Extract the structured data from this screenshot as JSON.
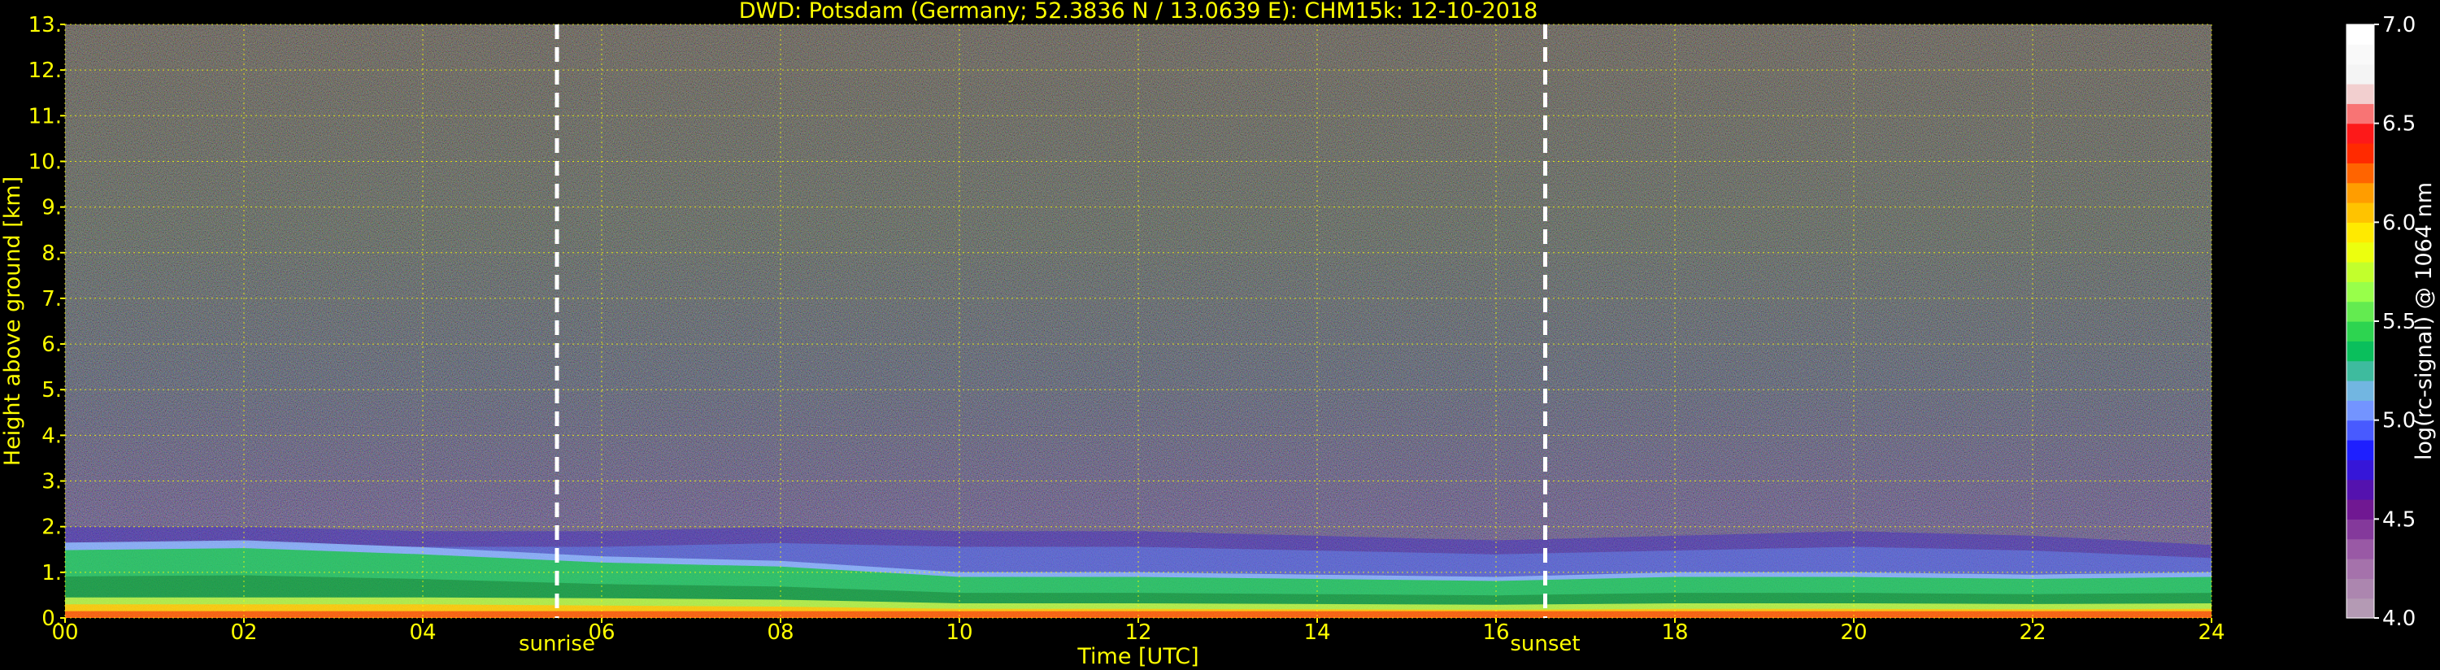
{
  "chart_data": {
    "type": "heatmap",
    "title": "DWD: Potsdam (Germany; 52.3836 N / 13.0639 E):    CHM15k: 12-10-2018",
    "xlabel": "Time [UTC]",
    "ylabel": "Height above ground [km]",
    "xlim": [
      0,
      24
    ],
    "ylim": [
      0,
      13
    ],
    "x_ticks": [
      "00",
      "02",
      "04",
      "06",
      "08",
      "10",
      "12",
      "14",
      "16",
      "18",
      "20",
      "22",
      "24"
    ],
    "y_ticks": [
      "0.",
      "1.",
      "2.",
      "3.",
      "4.",
      "5.",
      "6.",
      "7.",
      "8.",
      "9.",
      "10.",
      "11.",
      "12.",
      "13."
    ],
    "grid": true,
    "annotations": [
      {
        "label": "sunrise",
        "x": 5.5
      },
      {
        "label": "sunset",
        "x": 16.55
      }
    ],
    "colorbar": {
      "label": "log(rc-signal) @ 1064 nm",
      "range": [
        4.0,
        7.0
      ],
      "ticks": [
        "4.0",
        "4.5",
        "5.0",
        "5.5",
        "6.0",
        "6.5",
        "7.0"
      ]
    },
    "layers_km": {
      "time": [
        0,
        2,
        4,
        6,
        8,
        10,
        12,
        14,
        16,
        18,
        20,
        22,
        24
      ],
      "boundary_layer_top": [
        1.65,
        1.7,
        1.55,
        1.35,
        1.25,
        1.0,
        1.0,
        0.95,
        0.9,
        1.0,
        1.0,
        0.95,
        1.0
      ],
      "residual_layer_top": [
        2.0,
        2.0,
        1.9,
        1.9,
        2.0,
        1.9,
        1.9,
        1.8,
        1.7,
        1.8,
        1.9,
        1.8,
        1.6
      ]
    }
  },
  "colors": {
    "text": "#ffff00",
    "grid": "#ffff00",
    "background": "#000000",
    "colorbar_stops": [
      "#b49ab4",
      "#a065a8",
      "#6a0f8f",
      "#1a1aff",
      "#8ab4ff",
      "#00c050",
      "#90ff50",
      "#ffff00",
      "#ff9900",
      "#ff0000",
      "#f0f0f0",
      "#ffffff"
    ]
  }
}
